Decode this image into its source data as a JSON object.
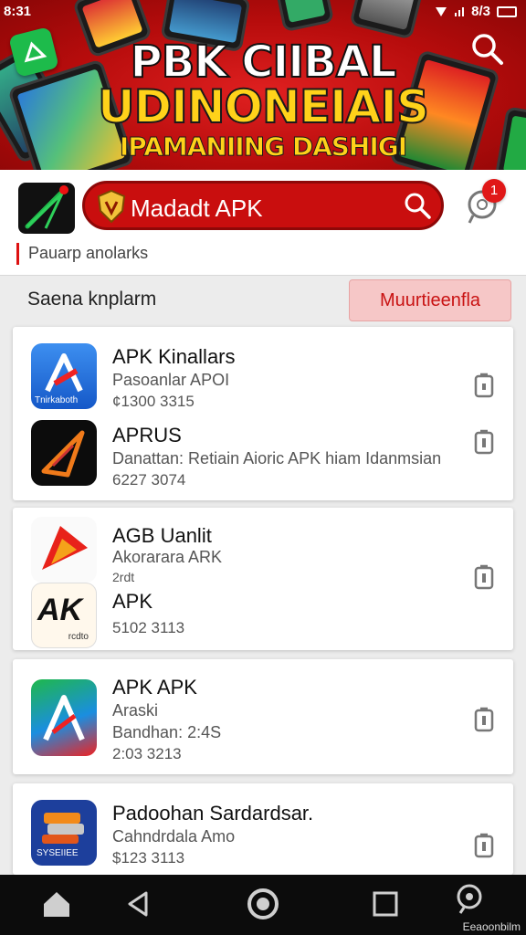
{
  "status_bar": {
    "time": "8:31",
    "right_text": "8/3",
    "icons": [
      "signal-icon",
      "wifi-icon",
      "battery-icon"
    ]
  },
  "banner": {
    "line1": "PBK CIIBAL",
    "line2": "UDINONEIAIS",
    "line3": "IPAMANIING DASHIGI"
  },
  "header": {
    "search_text": "Madadt APK",
    "notification_count": "1",
    "sub_label": "Pauarp anolarks"
  },
  "section": {
    "title": "Saena knplarm",
    "filter_label": "Muurtieenfla"
  },
  "apps": [
    {
      "name": "APK Kinallars",
      "desc": "Pasoanlar APOI",
      "size": "¢1300 3315",
      "icon_text": "Tnirkaboth"
    },
    {
      "name": "APRUS",
      "desc": "Danattan: Retiain  Aioric  APK hiam  Idanmsian",
      "size": "6227 3074"
    },
    {
      "name": "AGB Uanlit",
      "desc": "Akorarara ARK",
      "size": "2rdt"
    },
    {
      "name": "APK",
      "desc": "",
      "size": "5102 3113",
      "icon_text": "AK",
      "icon_sub": "rcdto"
    },
    {
      "name": "APK APK",
      "desc": "Araski",
      "extra": "Bandhan: 2:4S",
      "size": "2:03 3213"
    },
    {
      "name": "Padoohan Sardardsar.",
      "desc": "Cahndrdala Amo",
      "size": "$123 3113",
      "icon_text": "SYSEIIEE"
    }
  ],
  "bottom_nav": {
    "items": [
      "home-icon",
      "back-icon",
      "circle-home-icon",
      "recents-icon",
      "assistant-icon"
    ],
    "label": "Eeaoonbilm"
  },
  "colors": {
    "brand_red": "#c90e0e",
    "filter_bg": "#f6c7c7",
    "banner_yellow": "#ffd21a"
  }
}
